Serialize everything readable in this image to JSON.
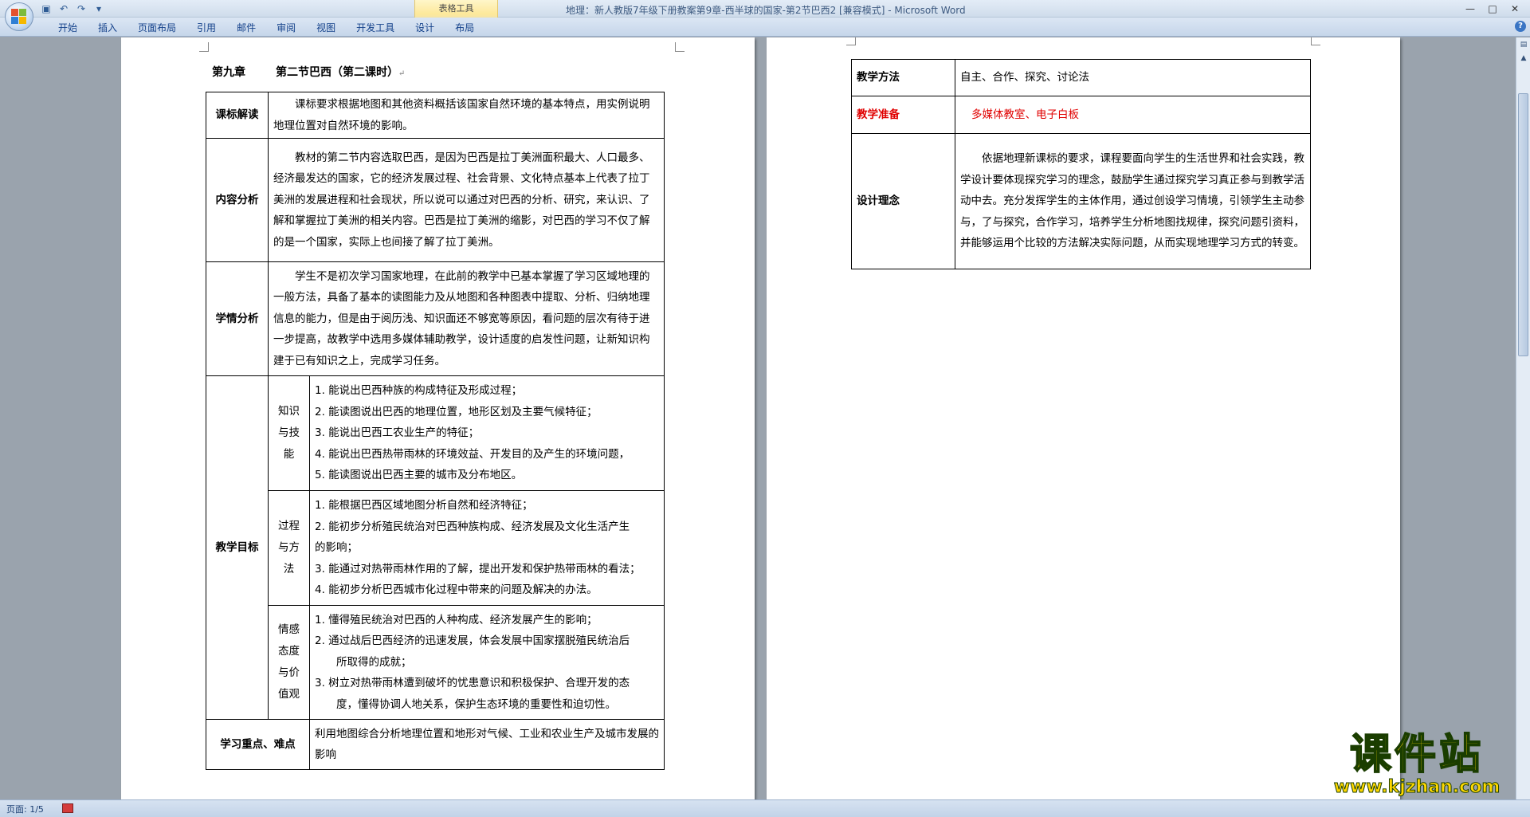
{
  "window": {
    "title": "地理：新人教版7年级下册教案第9章-西半球的国家-第2节巴西2 [兼容模式] - Microsoft Word",
    "contextual_tab_group": "表格工具",
    "controls": [
      "—",
      "□",
      "✕"
    ]
  },
  "ribbon": {
    "tabs": [
      "开始",
      "插入",
      "页面布局",
      "引用",
      "邮件",
      "审阅",
      "视图",
      "开发工具",
      "设计",
      "布局"
    ]
  },
  "page1": {
    "chapter": "第九章",
    "section": "第二节巴西（第二课时）",
    "rows": {
      "standard": {
        "label": "课标解读",
        "text": "课标要求根据地图和其他资料概括该国家自然环境的基本特点，用实例说明地理位置对自然环境的影响。"
      },
      "content": {
        "label": "内容分析",
        "text": "教材的第二节内容选取巴西，是因为巴西是拉丁美洲面积最大、人口最多、经济最发达的国家，它的经济发展过程、社会背景、文化特点基本上代表了拉丁美洲的发展进程和社会现状，所以说可以通过对巴西的分析、研究，来认识、了解和掌握拉丁美洲的相关内容。巴西是拉丁美洲的缩影，对巴西的学习不仅了解的是一个国家，实际上也间接了解了拉丁美洲。"
      },
      "learner": {
        "label": "学情分析",
        "text": "学生不是初次学习国家地理，在此前的教学中已基本掌握了学习区域地理的一般方法，具备了基本的读图能力及从地图和各种图表中提取、分析、归纳地理信息的能力，但是由于阅历浅、知识面还不够宽等原因，看问题的层次有待于进一步提高，故教学中选用多媒体辅助教学，设计适度的启发性问题，让新知识构建于已有知识之上，完成学习任务。"
      },
      "goals": {
        "label": "教学目标",
        "knowledge": {
          "label": "知识与技能",
          "items": [
            "1. 能说出巴西种族的构成特征及形成过程；",
            "2. 能读图说出巴西的地理位置，地形区划及主要气候特征；",
            "3. 能说出巴西工农业生产的特征；",
            "4. 能说出巴西热带雨林的环境效益、开发目的及产生的环境问题，",
            "5. 能读图说出巴西主要的城市及分布地区。"
          ]
        },
        "process": {
          "label": "过程与方法",
          "items": [
            "1. 能根据巴西区域地图分析自然和经济特征；",
            "2. 能初步分析殖民统治对巴西种族构成、经济发展及文化生活产生",
            "的影响；",
            "3. 能通过对热带雨林作用的了解，提出开发和保护热带雨林的看法；",
            "4. 能初步分析巴西城市化过程中带来的问题及解决的办法。"
          ]
        },
        "values": {
          "label": "情感态度与价值观",
          "items": [
            "1. 懂得殖民统治对巴西的人种构成、经济发展产生的影响；",
            "2. 通过战后巴西经济的迅速发展，体会发展中国家摆脱殖民统治后",
            "所取得的成就；",
            "3. 树立对热带雨林遭到破坏的忧患意识和积极保护、合理开发的态",
            "度，懂得协调人地关系，保护生态环境的重要性和迫切性。"
          ]
        }
      },
      "focus": {
        "label": "学习重点、难点",
        "text": "利用地图综合分析地理位置和地形对气候、工业和农业生产及城市发展的影响"
      }
    }
  },
  "page2": {
    "rows": {
      "method": {
        "label": "教学方法",
        "text": "自主、合作、探究、讨论法"
      },
      "prep": {
        "label": "教学准备",
        "text": "多媒体教室、电子白板"
      },
      "concept": {
        "label": "设计理念",
        "text": "依据地理新课标的要求，课程要面向学生的生活世界和社会实践，教学设计要体现探究学习的理念，鼓励学生通过探究学习真正参与到教学活动中去。充分发挥学生的主体作用，通过创设学习情境，引领学生主动参与，了与探究，合作学习，培养学生分析地图找规律，探究问题引资料，并能够运用个比较的方法解决实际问题，从而实现地理学习方式的转变。"
      }
    }
  },
  "status": {
    "page": "页面: 1/5"
  },
  "watermark": {
    "title": "课件站",
    "url": "www.kjzhan.com"
  },
  "colors": {
    "accent_red": "#e00000",
    "watermark_yellow": "#ffd800"
  }
}
